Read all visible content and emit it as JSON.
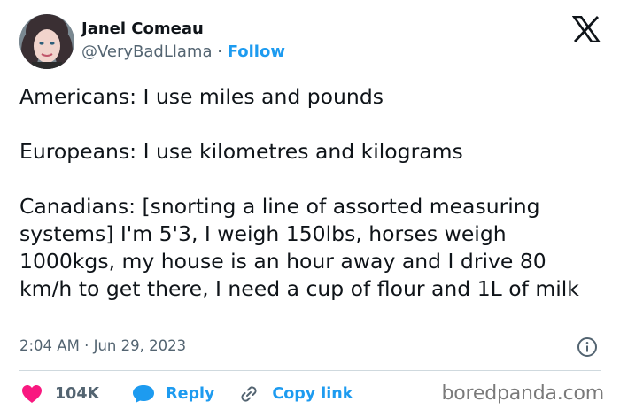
{
  "author": {
    "name": "Janel Comeau",
    "handle": "@VeryBadLlama",
    "separator": "·",
    "follow_label": "Follow"
  },
  "platform_icon": "x-logo-icon",
  "tweet": {
    "text": "Americans: I use miles and pounds\n\nEuropeans: I use kilometres and kilograms\n\nCanadians: [snorting a line of assorted measuring systems] I'm 5'3, I weigh 150lbs, horses weigh 1000kgs, my house is an hour away and I drive 80 km/h to get there, I need a cup of flour and 1L of milk"
  },
  "meta": {
    "time": "2:04 AM",
    "separator": "·",
    "date": "Jun 29, 2023",
    "info_icon": "info-icon"
  },
  "actions": {
    "likes": {
      "icon": "heart-icon",
      "label": "104K"
    },
    "reply": {
      "icon": "speech-bubble-icon",
      "label": "Reply"
    },
    "copy_link": {
      "icon": "link-icon",
      "label": "Copy link"
    }
  },
  "watermark": "boredpanda.com",
  "colors": {
    "accent": "#1d9bf0",
    "heart": "#f91880",
    "text": "#0f1419",
    "muted": "#536471",
    "divider": "#cfd9de",
    "watermark": "#7a7a7a"
  }
}
